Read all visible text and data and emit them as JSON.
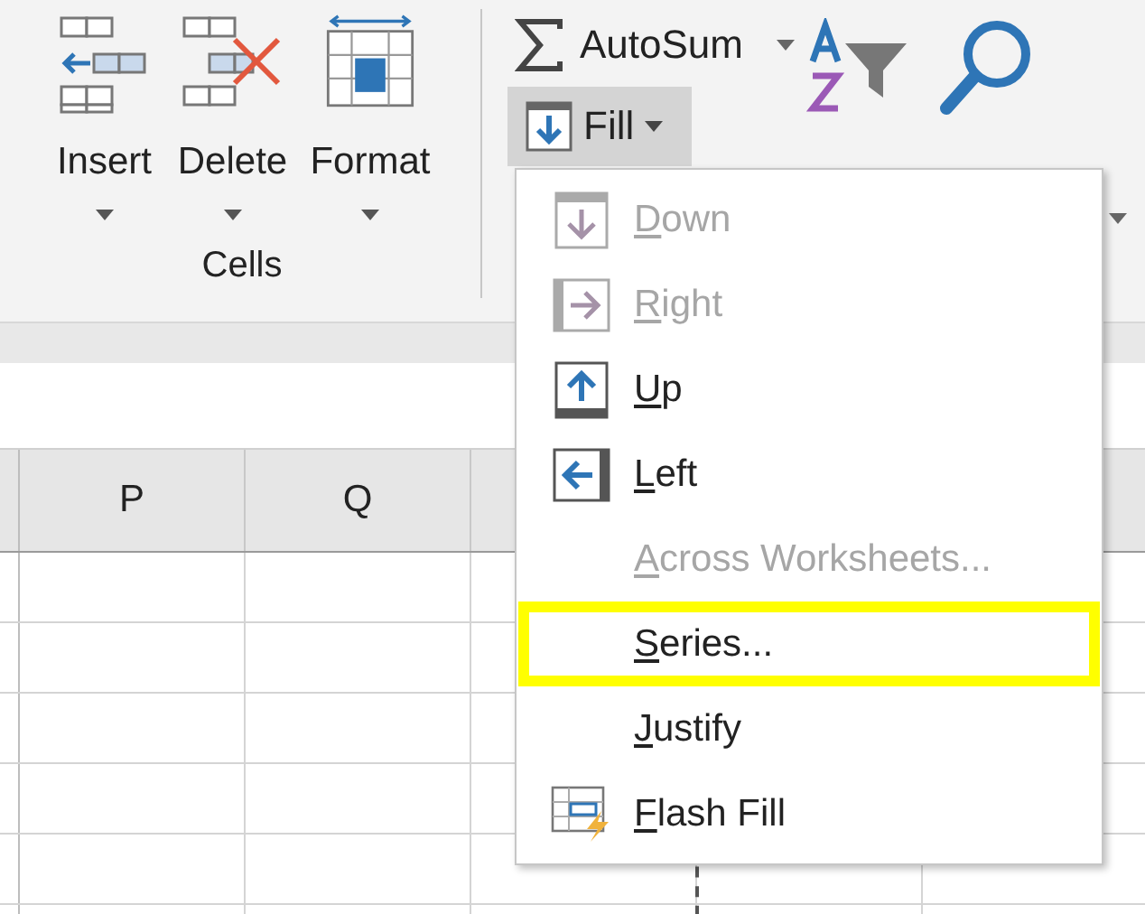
{
  "ribbon": {
    "cells_group": {
      "label": "Cells",
      "buttons": [
        {
          "kind": "insert",
          "label": "Insert"
        },
        {
          "kind": "delete",
          "label": "Delete"
        },
        {
          "kind": "format",
          "label": "Format"
        }
      ]
    },
    "editing_group": {
      "autosum": {
        "label": "AutoSum"
      },
      "fill": {
        "label": "Fill",
        "selected": true
      }
    }
  },
  "columns": [
    "P",
    "Q"
  ],
  "fill_menu": {
    "items": [
      {
        "kind": "down",
        "label": "Down",
        "disabled": true,
        "highlighted": false
      },
      {
        "kind": "right",
        "label": "Right",
        "disabled": true,
        "highlighted": false
      },
      {
        "kind": "up",
        "label": "Up",
        "disabled": false,
        "highlighted": false
      },
      {
        "kind": "left",
        "label": "Left",
        "disabled": false,
        "highlighted": false
      },
      {
        "kind": "plain",
        "label": "Across Worksheets...",
        "disabled": true,
        "highlighted": false
      },
      {
        "kind": "plain",
        "label": "Series...",
        "disabled": false,
        "highlighted": true
      },
      {
        "kind": "plain",
        "label": "Justify",
        "disabled": false,
        "highlighted": false
      },
      {
        "kind": "flash",
        "label": "Flash Fill",
        "disabled": false,
        "highlighted": false
      }
    ]
  }
}
